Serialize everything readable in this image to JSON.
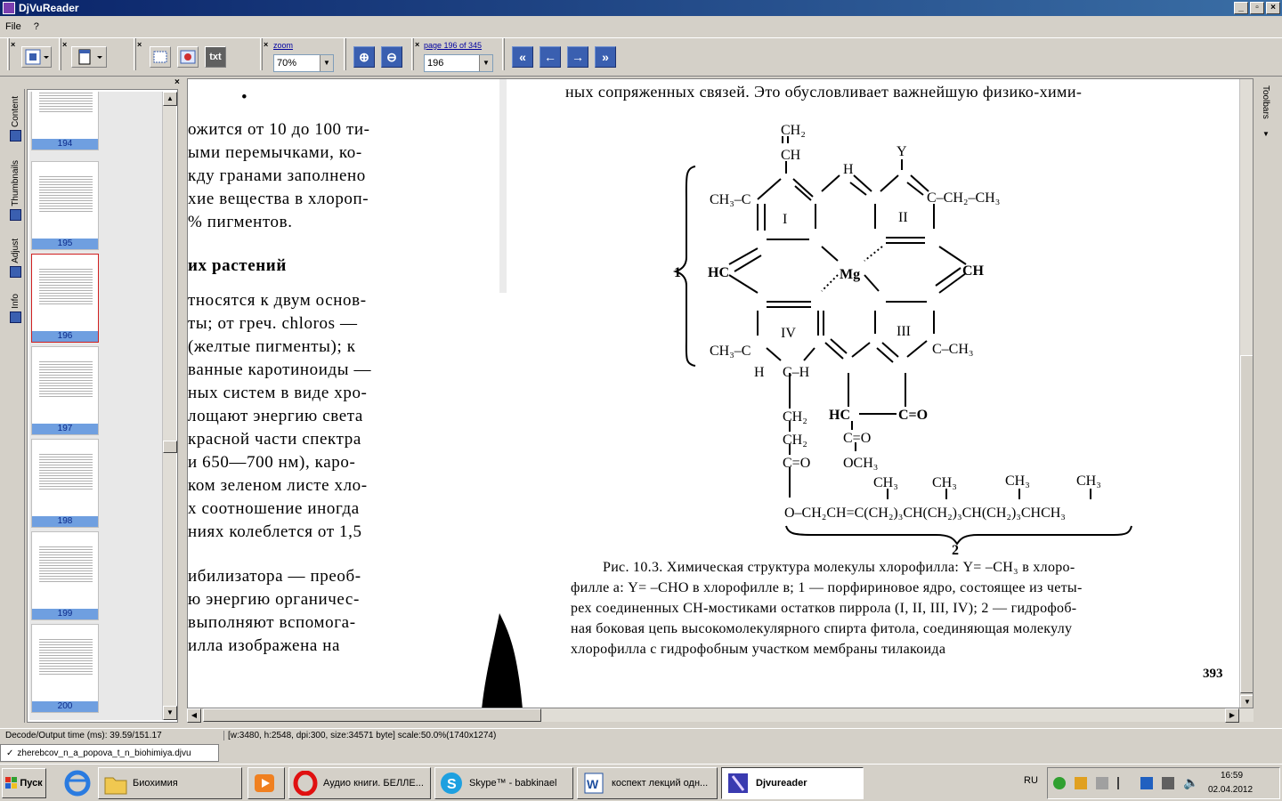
{
  "window": {
    "title": "DjVuReader",
    "min": "_",
    "restore": "▫",
    "close": "×"
  },
  "menu": [
    "File",
    "?"
  ],
  "toolbar": {
    "zoom_label": "zoom",
    "zoom_value": "70%",
    "page_label": "page 196 of 345",
    "page_value": "196",
    "txt_button": "txt"
  },
  "sidetabs": [
    "Content",
    "Thumbnails",
    "Adjust",
    "Info"
  ],
  "thumbnails": [
    "194",
    "195",
    "196",
    "197",
    "198",
    "199",
    "200"
  ],
  "selected_thumbnail": "196",
  "left_page_lines": [
    "•",
    "ожится от 10 до 100 ти-",
    "ыми перемычками, ко-",
    "кду гранами заполнено",
    "хие вещества в хлороп-",
    "% пигментов.",
    "их растений",
    "тносятся к двум основ-",
    "ты; от греч. chloros —",
    "(желтые пигменты); к",
    "ванные каротиноиды —",
    "ных систем в виде хро-",
    "лощают энергию света",
    "красной части спектра",
    " и 650—700 нм), каро-",
    "ком зеленом листе хло-",
    "х соотношение иногда",
    "ниях колеблется от 1,5",
    "ибилизатора — преоб-",
    "ю энергию органичес-",
    "выполняют вспомога-",
    "илла изображена на"
  ],
  "right_page_top": "ных сопряженных связей. Это обусловливает важнейшую физико-хими-",
  "formula": {
    "ch2": "CH₂",
    "ch": "CH",
    "y": "Y",
    "ch3a": "CH₃–C",
    "ch2ch3": "C–CH₂–CH₃",
    "r1": "I",
    "r2": "II",
    "r3": "III",
    "r4": "IV",
    "mg": "Mg",
    "hc": "HC",
    "ch_r": "CH",
    "ch3b": "CH₃–C",
    "ch3c": "C–CH₃",
    "h": "H",
    "ch_h": "C–H",
    "label1": "1",
    "label2": "2",
    "chain1": "CH₂",
    "chain2": "CH₂",
    "ceo": "C=O",
    "hc2": "HC",
    "c_o": "C=O",
    "c_o2": "C=O",
    "och3": "OCH₃",
    "phytol": "O–CH₂CH=C(CH₂)₃CH(CH₂)₃CH(CH₂)₃CHCH₃",
    "me1": "CH₃",
    "me2": "CH₃",
    "me3": "CH₃",
    "me4": "CH₃"
  },
  "caption_lines": [
    "Рис. 10.3. Химическая структура молекулы хлорофилла: Y= –CH₃ в хлоро-",
    "филле а: Y= –CHO в хлорофилле в; 1 — порфириновое ядро, состоящее из четы-",
    "рех соединенных CH-мостиками остатков пиррола (I, II, III, IV); 2 — гидрофоб-",
    "ная боковая цепь высокомолекулярного спирта фитола, соединяющая молекулу",
    "хлорофилла с гидрофобным участком мембраны тилакоида"
  ],
  "page_number": "393",
  "toolbars_tab": "Toolbars",
  "status": {
    "decode": "Decode/Output time (ms): 39.59/151.17",
    "info": "[w:3480, h:2548, dpi:300, size:34571 byte] scale:50.0%(1740x1274)"
  },
  "file_tab": "zherebcov_n_a_popova_t_n_biohimiya.djvu",
  "taskbar": {
    "start": "Пуск",
    "items": [
      "Биохимия",
      "Аудио книги. БЕЛЛЕ...",
      "Skype™ - babkinael",
      "коспект лекций одн...",
      "Djvureader"
    ],
    "lang": "RU",
    "time": "16:59",
    "date": "02.04.2012"
  },
  "colors": {
    "accent": "#0a246a",
    "thumb_label": "#6f9fe0",
    "selected": "#d02020"
  }
}
